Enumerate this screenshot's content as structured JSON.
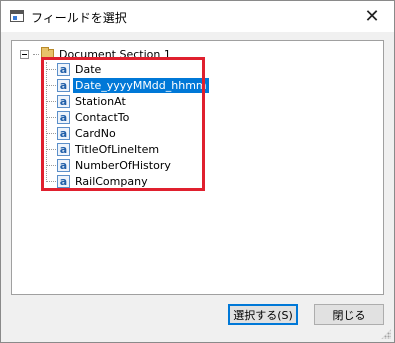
{
  "window": {
    "title": "フィールドを選択",
    "close_symbol": "✕"
  },
  "tree": {
    "root_label": "Document Section 1",
    "field_icon_glyph": "a",
    "items": [
      {
        "label": "Date",
        "selected": false
      },
      {
        "label": "Date_yyyyMMdd_hhmm",
        "selected": true
      },
      {
        "label": "StationAt",
        "selected": false
      },
      {
        "label": "ContactTo",
        "selected": false
      },
      {
        "label": "CardNo",
        "selected": false
      },
      {
        "label": "TitleOfLineItem",
        "selected": false
      },
      {
        "label": "NumberOfHistory",
        "selected": false
      },
      {
        "label": "RailCompany",
        "selected": false
      }
    ]
  },
  "buttons": {
    "select_label": "選択する(S)",
    "close_label": "閉じる"
  },
  "colors": {
    "selection": "#0078d7",
    "highlight_border": "#e0202e"
  }
}
